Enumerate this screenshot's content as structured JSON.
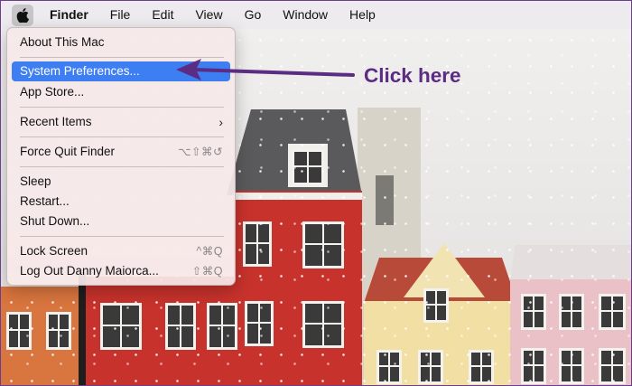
{
  "menubar": {
    "app_name": "Finder",
    "items": [
      "File",
      "Edit",
      "View",
      "Go",
      "Window",
      "Help"
    ]
  },
  "apple_menu": {
    "items": [
      {
        "label": "About This Mac",
        "shortcut": ""
      },
      {
        "label": "System Preferences...",
        "shortcut": ""
      },
      {
        "label": "App Store...",
        "shortcut": ""
      },
      {
        "label": "Recent Items",
        "shortcut": "›"
      },
      {
        "label": "Force Quit Finder",
        "shortcut": "⌥⇧⌘↺"
      },
      {
        "label": "Sleep",
        "shortcut": ""
      },
      {
        "label": "Restart...",
        "shortcut": ""
      },
      {
        "label": "Shut Down...",
        "shortcut": ""
      },
      {
        "label": "Lock Screen",
        "shortcut": "^⌘Q"
      },
      {
        "label": "Log Out Danny Maiorca...",
        "shortcut": "⇧⌘Q"
      }
    ],
    "selected_index": 1
  },
  "annotation": {
    "text": "Click here",
    "color": "#5b2c83"
  },
  "colors": {
    "highlight": "#3e7ef3",
    "frame_border": "#6a3d8f"
  },
  "icons": {
    "apple": "apple-icon",
    "submenu": "chevron-right-icon"
  }
}
